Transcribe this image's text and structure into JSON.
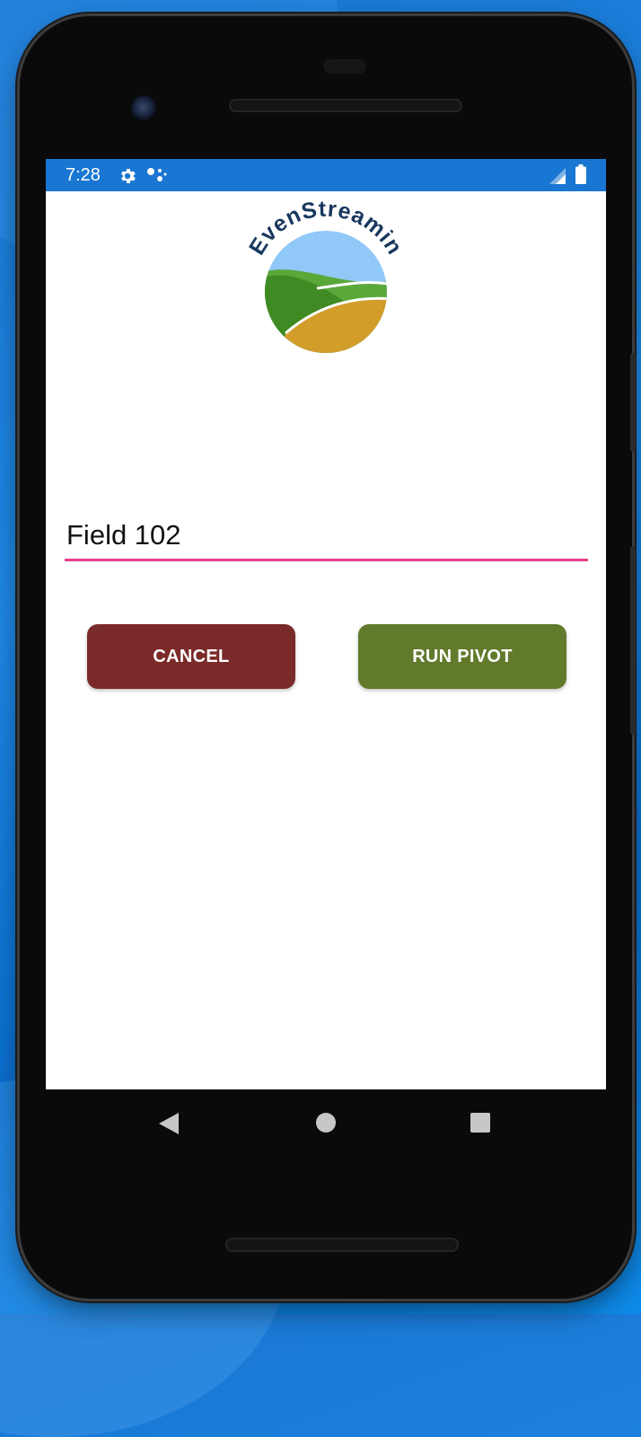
{
  "status_bar": {
    "time": "7:28",
    "icons": [
      "gear-icon",
      "dots-icon",
      "signal-icon",
      "battery-icon"
    ],
    "color": "#1976d2"
  },
  "logo": {
    "text": "EvenStreamin",
    "colors": {
      "sky": "#90c8f8",
      "dark_green": "#3f8a22",
      "light_green": "#5aa83a",
      "gold": "#d39d2a",
      "text": "#17385e"
    }
  },
  "field_input": {
    "value": "Field 102",
    "underline_color": "#e8408a"
  },
  "buttons": {
    "cancel_label": "CANCEL",
    "cancel_color": "#7a2a28",
    "run_label": "RUN PIVOT",
    "run_color": "#627a2c"
  },
  "nav_bar": {
    "icons": [
      "back-icon",
      "home-icon",
      "recents-icon"
    ]
  }
}
